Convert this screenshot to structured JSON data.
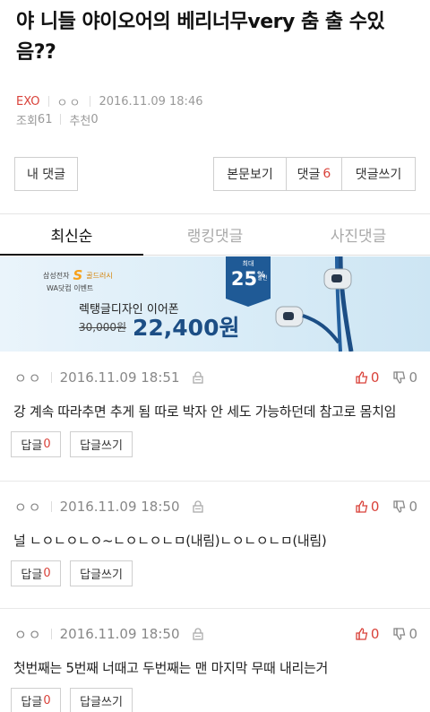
{
  "post": {
    "title": "야 니들 야이오어의 베리너무very 춤 출 수있음??",
    "author": "EXO",
    "nickname": "ㅇㅇ",
    "datetime": "2016.11.09 18:46",
    "views_label": "조회",
    "views": "61",
    "recommend_label": "추천",
    "recommend": "0"
  },
  "toolbar": {
    "my_comments": "내 댓글",
    "view_post": "본문보기",
    "comments_label": "댓글",
    "comments_count": "6",
    "write_comment": "댓글쓰기"
  },
  "tabs": [
    {
      "label": "최신순",
      "active": true
    },
    {
      "label": "랭킹댓글",
      "active": false
    },
    {
      "label": "사진댓글",
      "active": false
    }
  ],
  "ad": {
    "brand": "삼성전자",
    "brand_s": "S",
    "brand_gold": "골드러시",
    "event": "WA닷컴 이벤트",
    "product": "렉탱글디자인 이어폰",
    "old_price": "30,000원",
    "price": "22,400원",
    "badge_top": "최대",
    "badge_num": "25",
    "badge_pct": "%",
    "badge_sub": "할인"
  },
  "comments": [
    {
      "nick": "ㅇㅇ",
      "datetime": "2016.11.09 18:51",
      "up": "0",
      "down": "0",
      "text": "강 계속 따라추면 추게 됨 따로 박자 안 세도 가능하던데 참고로 몸치임",
      "reply_label": "답글",
      "reply_count": "0",
      "write_reply": "답글쓰기"
    },
    {
      "nick": "ㅇㅇ",
      "datetime": "2016.11.09 18:50",
      "up": "0",
      "down": "0",
      "text": "널 ㄴㅇㄴㅇㄴㅇ~ㄴㅇㄴㅇㄴㅁ(내림)ㄴㅇㄴㅇㄴㅁ(내림)",
      "reply_label": "답글",
      "reply_count": "0",
      "write_reply": "답글쓰기"
    },
    {
      "nick": "ㅇㅇ",
      "datetime": "2016.11.09 18:50",
      "up": "0",
      "down": "0",
      "text": "첫번째는 5번째 너때고 두번째는 맨 마지막 무때 내리는거",
      "reply_label": "답글",
      "reply_count": "0",
      "write_reply": "답글쓰기"
    }
  ],
  "colors": {
    "accent_red": "#d9423a",
    "ad_blue": "#1f5a96"
  }
}
